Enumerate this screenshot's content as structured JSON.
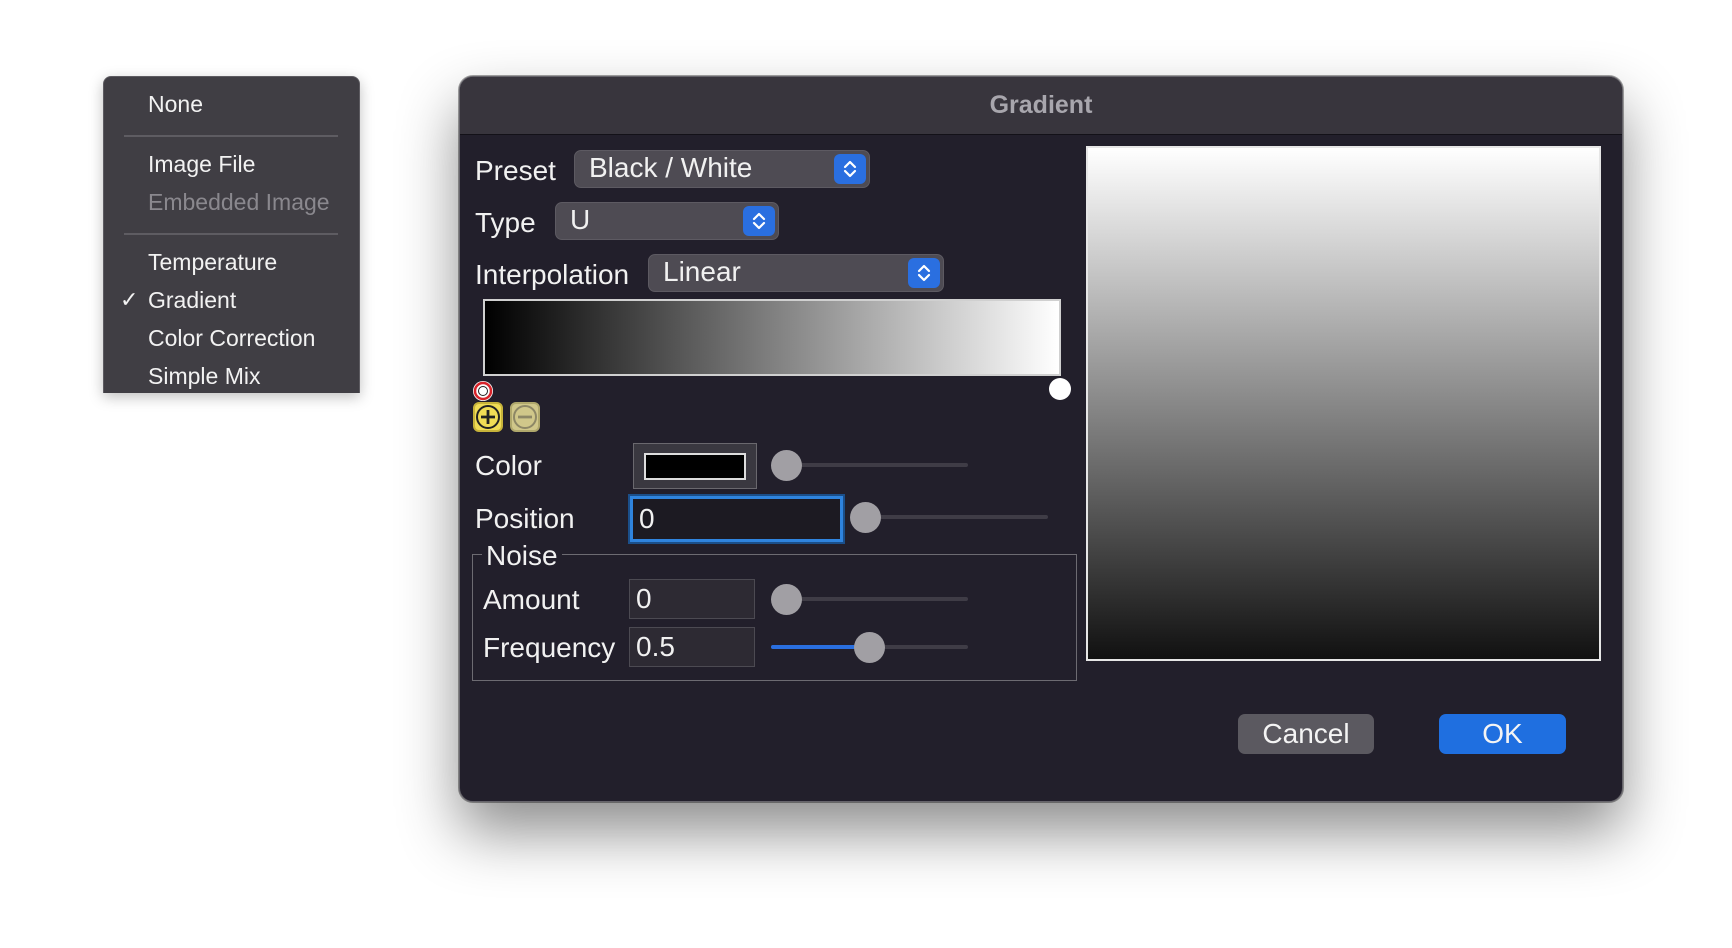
{
  "menu": {
    "items": [
      {
        "label": "None",
        "checked": false,
        "enabled": true
      },
      {
        "label": "Image File",
        "checked": false,
        "enabled": true
      },
      {
        "label": "Embedded Image",
        "checked": false,
        "enabled": false
      },
      {
        "label": "Temperature",
        "checked": false,
        "enabled": true
      },
      {
        "label": "Gradient",
        "checked": true,
        "enabled": true
      },
      {
        "label": "Color Correction",
        "checked": false,
        "enabled": true
      },
      {
        "label": "Simple Mix",
        "checked": false,
        "enabled": true
      }
    ],
    "check_mark": "✓"
  },
  "dialog": {
    "title": "Gradient",
    "preset": {
      "label": "Preset",
      "value": "Black / White"
    },
    "type": {
      "label": "Type",
      "value": "U"
    },
    "interpolation": {
      "label": "Interpolation",
      "value": "Linear"
    },
    "gradient": {
      "start_color": "#000000",
      "end_color": "#ffffff"
    },
    "color": {
      "label": "Color",
      "value": "#000000",
      "slider_value": 0
    },
    "position": {
      "label": "Position",
      "value": "0",
      "slider_value": 0
    },
    "noise": {
      "title": "Noise",
      "amount": {
        "label": "Amount",
        "value": "0",
        "slider_value": 0
      },
      "frequency": {
        "label": "Frequency",
        "value": "0.5",
        "slider_value": 0.5
      }
    },
    "buttons": {
      "cancel": "Cancel",
      "ok": "OK"
    },
    "accent_color": "#2a6fe0"
  }
}
